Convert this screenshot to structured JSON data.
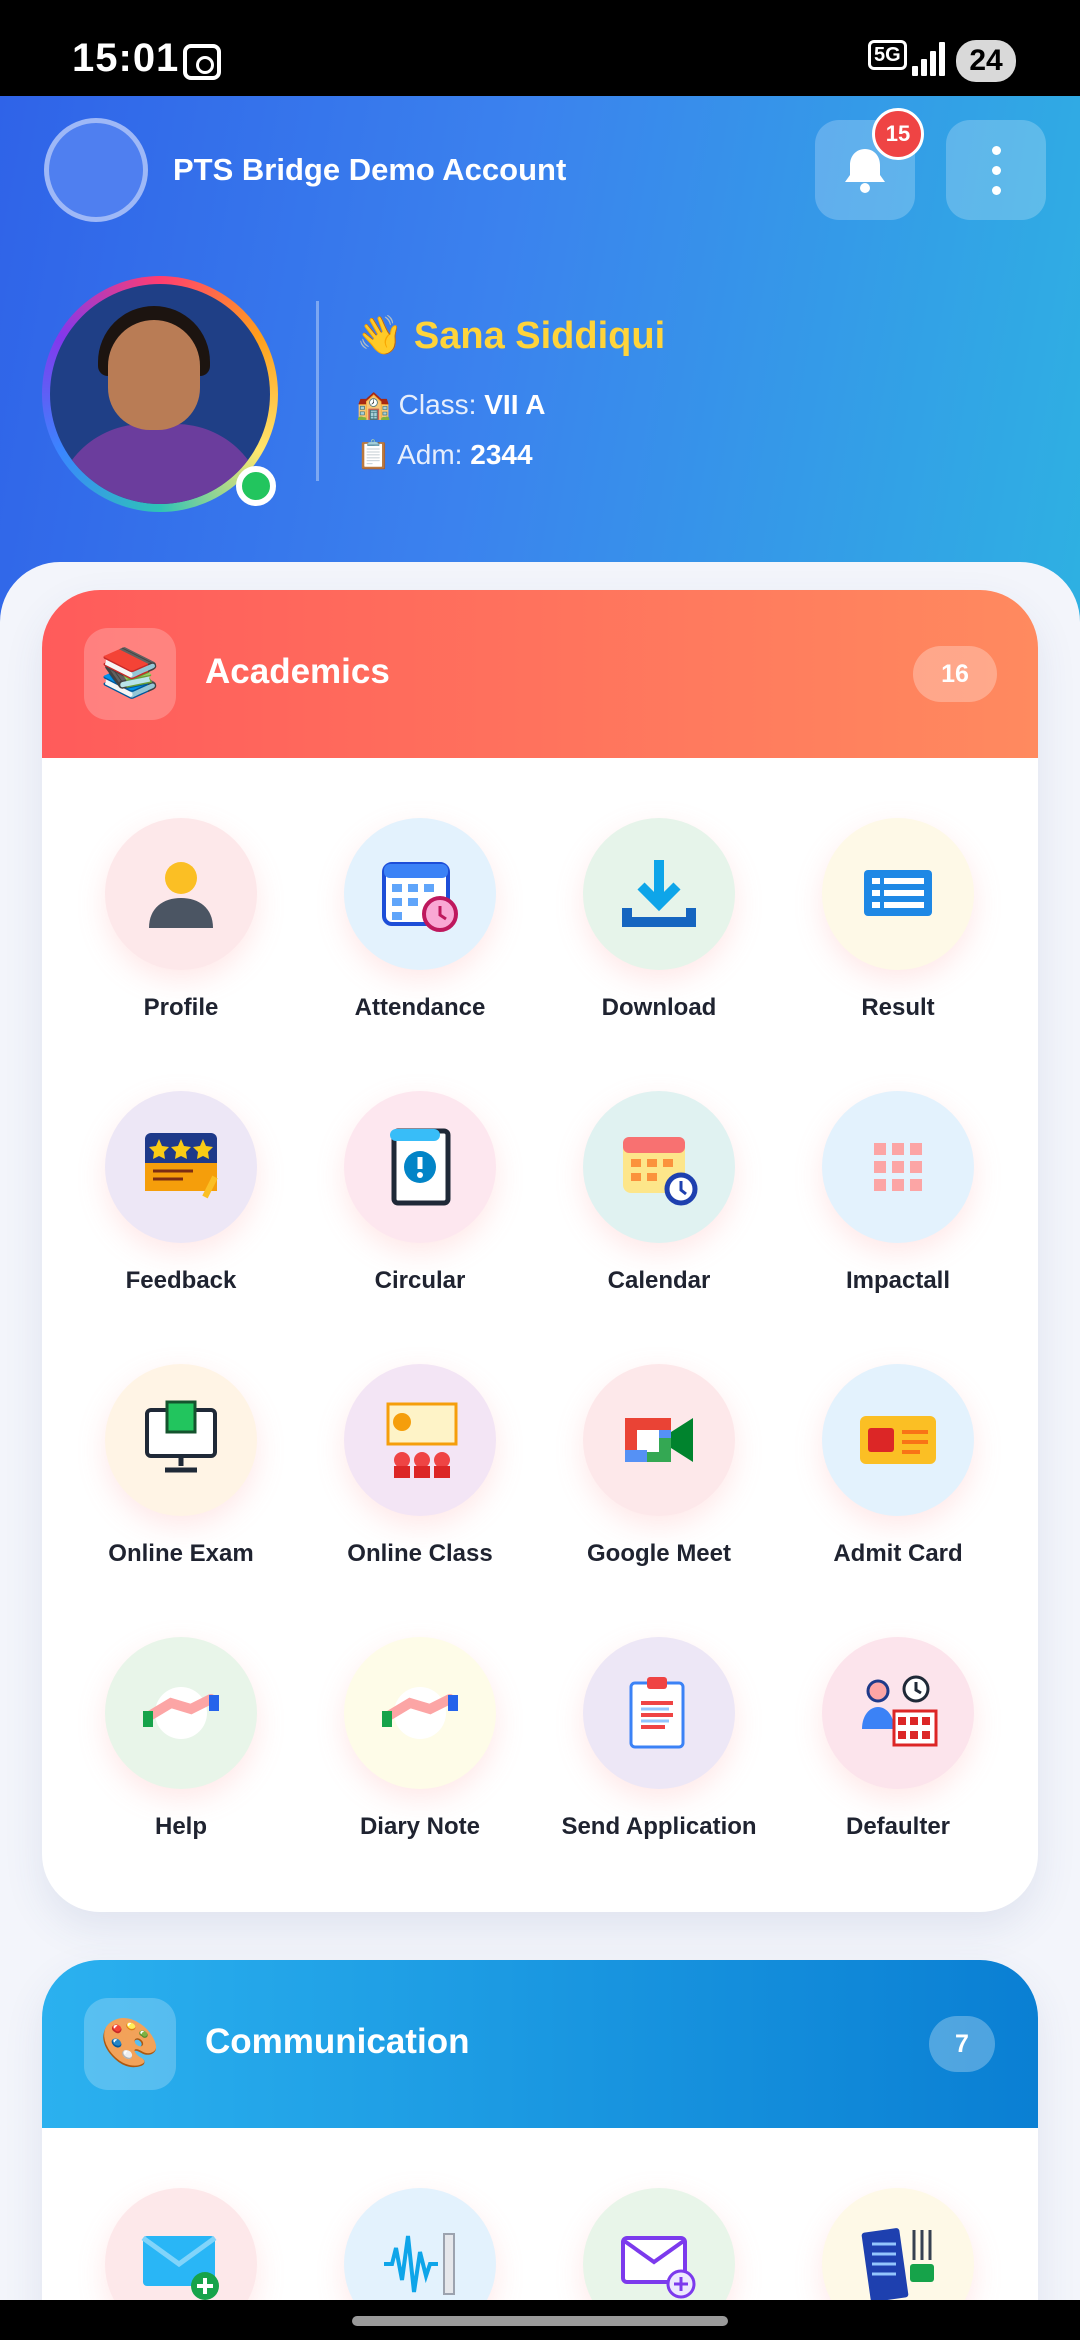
{
  "status_bar": {
    "time": "15:01",
    "network": "5G",
    "battery": "24"
  },
  "header": {
    "account_name": "PTS Bridge Demo Account",
    "notification_count": "15"
  },
  "student": {
    "wave": "👋",
    "name": "Sana Siddiqui",
    "class_icon": "🏫",
    "class_label": "Class:",
    "class_value": "VII A",
    "adm_icon": "📋",
    "adm_label": "Adm:",
    "adm_value": "2344"
  },
  "academics": {
    "icon": "📚",
    "title": "Academics",
    "count": "16",
    "items": [
      {
        "label": "Profile",
        "icon": "person-icon"
      },
      {
        "label": "Attendance",
        "icon": "attendance-calendar-icon"
      },
      {
        "label": "Download",
        "icon": "download-icon"
      },
      {
        "label": "Result",
        "icon": "result-sheet-icon"
      },
      {
        "label": "Feedback",
        "icon": "feedback-stars-icon"
      },
      {
        "label": "Circular",
        "icon": "circular-notice-icon"
      },
      {
        "label": "Calendar",
        "icon": "calendar-clock-icon"
      },
      {
        "label": "Impactall",
        "icon": "grid-icon"
      },
      {
        "label": "Online Exam",
        "icon": "computer-exam-icon"
      },
      {
        "label": "Online Class",
        "icon": "online-class-icon"
      },
      {
        "label": "Google Meet",
        "icon": "google-meet-icon"
      },
      {
        "label": "Admit Card",
        "icon": "admit-card-icon"
      },
      {
        "label": "Help",
        "icon": "handshake-icon"
      },
      {
        "label": "Diary Note",
        "icon": "handshake-icon"
      },
      {
        "label": "Send Application",
        "icon": "clipboard-icon"
      },
      {
        "label": "Defaulter",
        "icon": "defaulter-icon"
      }
    ]
  },
  "communication": {
    "icon": "🎨",
    "title": "Communication",
    "count": "7",
    "items": [
      {
        "icon": "mail-add-icon"
      },
      {
        "icon": "voice-wave-icon"
      },
      {
        "icon": "email-settings-icon"
      },
      {
        "icon": "menu-card-icon"
      }
    ]
  },
  "colors": {
    "header_start": "#2f63e8",
    "header_end": "#2eb1e2",
    "academics_start": "#ff5b5b",
    "academics_end": "#ff8a5f",
    "communication_start": "#2bb1ef",
    "communication_end": "#0a7fd3",
    "badge_red": "#ef4444",
    "name_yellow": "#ffd43b"
  }
}
